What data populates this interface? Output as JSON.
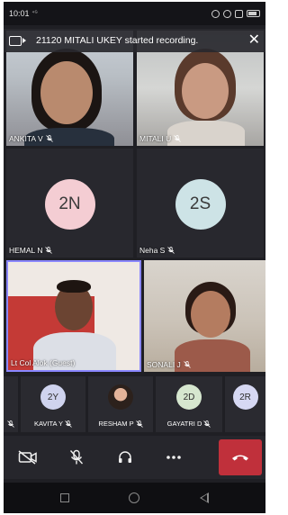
{
  "status_bar": {
    "time": "10:01",
    "network": "⁴ᴳ",
    "icons": [
      "alarm-icon",
      "wifi-icon",
      "headset-icon",
      "battery-icon"
    ]
  },
  "banner": {
    "text": "21120 MITALI UKEY started recording.",
    "icon": "video-record-icon",
    "close_icon": "close-icon"
  },
  "participants": [
    {
      "name": "ANKITA V",
      "muted": true,
      "type": "video"
    },
    {
      "name": "MITALI U",
      "muted": true,
      "type": "video"
    },
    {
      "name": "HEMAL N",
      "muted": true,
      "type": "avatar",
      "initials": "2N",
      "color": "#f4cdd3"
    },
    {
      "name": "Neha S",
      "muted": true,
      "type": "avatar",
      "initials": "2S",
      "color": "#cde3e6"
    },
    {
      "name": "Lt Col Alok (Guest)",
      "muted": false,
      "type": "video",
      "active_speaker": true
    },
    {
      "name": "SONALI J",
      "muted": true,
      "type": "video"
    }
  ],
  "strip": [
    {
      "name": "",
      "muted": true
    },
    {
      "name": "KAVITA Y",
      "initials": "2Y",
      "color": "#cfd3ee",
      "muted": true
    },
    {
      "name": "RESHAM P",
      "photo": true,
      "muted": true
    },
    {
      "name": "GAYATRI D",
      "initials": "2D",
      "color": "#d6e7cf",
      "muted": true
    },
    {
      "name": "",
      "initials": "2R",
      "color": "#d6d8f3",
      "muted": false
    }
  ],
  "controls": {
    "camera": "camera-off-icon",
    "mic": "mic-off-icon",
    "audio": "headset-icon",
    "more": "more-icon",
    "hangup": "hang-up-icon",
    "hangup_color": "#c0303b"
  },
  "colors": {
    "background": "#1f1f24",
    "active_speaker_border": "#8a87ff"
  }
}
